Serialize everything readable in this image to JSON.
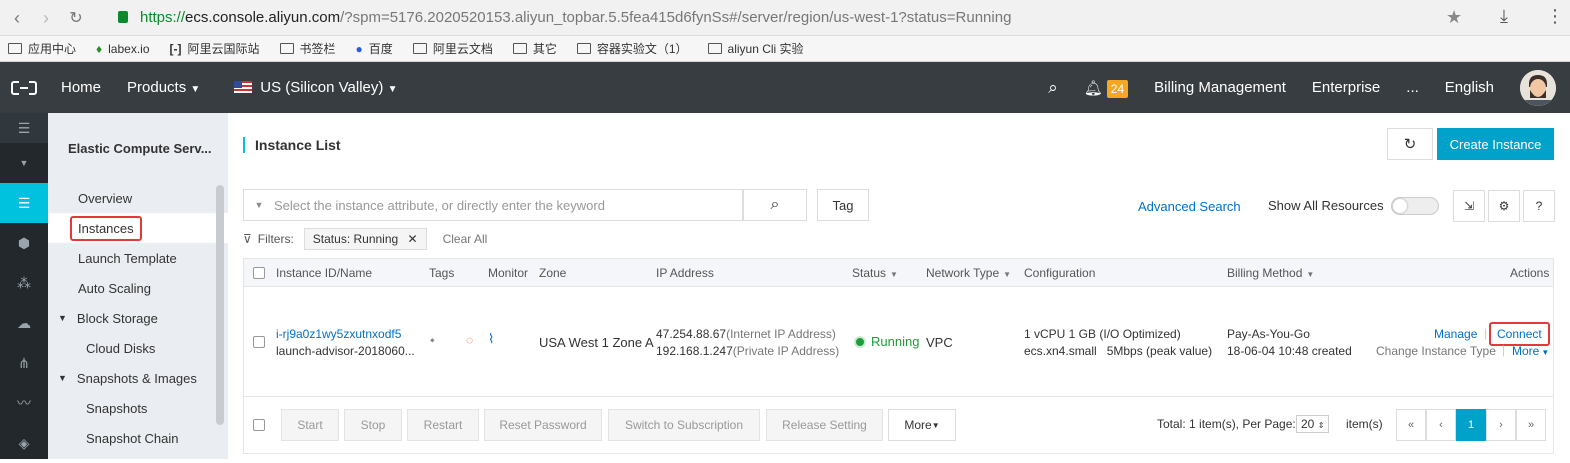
{
  "browser": {
    "url_proto": "https://",
    "url_host": "ecs.console.aliyun.com",
    "url_rest": "/?spm=5176.2020520153.aliyun_topbar.5.5fea415d6fynSs#/server/region/us-west-1?status=Running",
    "bookmarks": [
      "应用中心",
      "labex.io",
      "阿里云国际站",
      "书签栏",
      "百度",
      "阿里云文档",
      "其它",
      "容器实验文（1）",
      "aliyun Cli 实验"
    ]
  },
  "topnav": {
    "home": "Home",
    "products": "Products",
    "region": "US (Silicon Valley)",
    "notifications": "24",
    "billing": "Billing Management",
    "enterprise": "Enterprise",
    "more": "...",
    "language": "English"
  },
  "sidemenu": {
    "title": "Elastic Compute Serv...",
    "items": [
      "Overview",
      "Instances",
      "Launch Template",
      "Auto Scaling"
    ],
    "block_storage": "Block Storage",
    "cloud_disks": "Cloud Disks",
    "snapshots_images": "Snapshots & Images",
    "snapshots": "Snapshots",
    "snapshot_chain": "Snapshot Chain"
  },
  "page": {
    "title": "Instance List",
    "create": "Create Instance",
    "search_placeholder": "Select the instance attribute, or directly enter the keyword",
    "tag": "Tag",
    "advanced_search": "Advanced Search",
    "show_all": "Show All Resources",
    "filters_label": "Filters:",
    "filter_chip": "Status: Running",
    "clear_all": "Clear All"
  },
  "table": {
    "headers": {
      "id": "Instance ID/Name",
      "tags": "Tags",
      "monitor": "Monitor",
      "zone": "Zone",
      "ip": "IP Address",
      "status": "Status",
      "network": "Network Type",
      "config": "Configuration",
      "billing": "Billing Method",
      "actions": "Actions"
    },
    "row": {
      "id": "i-rj9a0z1wy5zxutnxodf5",
      "name": "launch-advisor-2018060...",
      "zone": "USA West 1 Zone A",
      "ip_public": "47.254.88.67",
      "ip_public_note": "(Internet IP Address)",
      "ip_private": "192.168.1.247",
      "ip_private_note": "(Private IP Address)",
      "status": "Running",
      "network": "VPC",
      "config1": "1 vCPU 1 GB (I/O Optimized)",
      "config2": "ecs.xn4.small   5Mbps (peak value)",
      "billing1": "Pay-As-You-Go",
      "billing2": "18-06-04 10:48 created",
      "manage": "Manage",
      "connect": "Connect",
      "change_type": "Change Instance Type",
      "more": "More"
    },
    "footer": {
      "start": "Start",
      "stop": "Stop",
      "restart": "Restart",
      "reset_password": "Reset Password",
      "switch_sub": "Switch to Subscription",
      "release": "Release Setting",
      "more": "More",
      "total": "Total: 1 item(s), Per Page:",
      "per_page": "20",
      "items": "item(s)",
      "page": "1"
    }
  },
  "colors": {
    "accent": "#00a2ca",
    "nav_bg": "#373d41",
    "highlight": "#e4393c"
  }
}
